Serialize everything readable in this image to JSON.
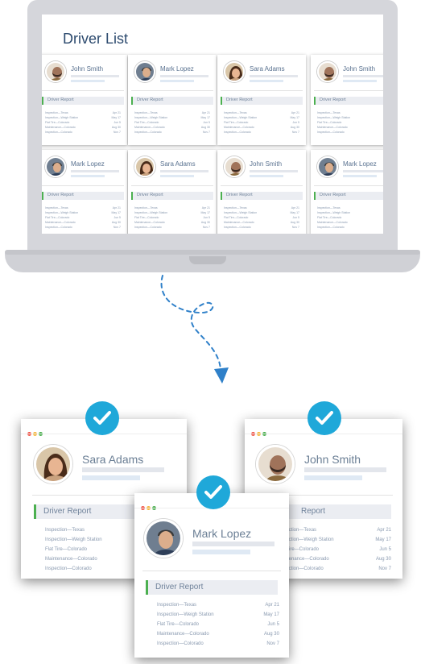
{
  "screen": {
    "title": "Driver List",
    "report_label": "Driver Report",
    "grid": [
      {
        "name": "John Smith",
        "avatar": "man-beard"
      },
      {
        "name": "Mark Lopez",
        "avatar": "man-short-hair"
      },
      {
        "name": "Sara Adams",
        "avatar": "woman-long-hair"
      },
      {
        "name": "John Smith",
        "avatar": "man-beard"
      },
      {
        "name": "Mark Lopez",
        "avatar": "man-short-hair"
      },
      {
        "name": "Sara Adams",
        "avatar": "woman-long-hair"
      },
      {
        "name": "John Smith",
        "avatar": "man-beard"
      },
      {
        "name": "Mark Lopez",
        "avatar": "man-short-hair"
      }
    ]
  },
  "report_rows": [
    {
      "label": "Inspection—Texas",
      "date": "Apr 21"
    },
    {
      "label": "Inspection—Weigh Station",
      "date": "May 17"
    },
    {
      "label": "Flat Tire—Colorado",
      "date": "Jun 5"
    },
    {
      "label": "Maintenance—Colorado",
      "date": "Aug 30"
    },
    {
      "label": "Inspection—Colorado",
      "date": "Nov 7"
    }
  ],
  "cards": {
    "left": {
      "name": "Sara Adams",
      "report_label": "Driver Report"
    },
    "right": {
      "name": "John Smith",
      "report_label": "Report"
    },
    "center": {
      "name": "Mark Lopez",
      "report_label": "Driver Report"
    }
  },
  "colors": {
    "accent_green": "#4cb050",
    "check_blue": "#1fa8d9",
    "path_blue": "#2f80c9"
  }
}
